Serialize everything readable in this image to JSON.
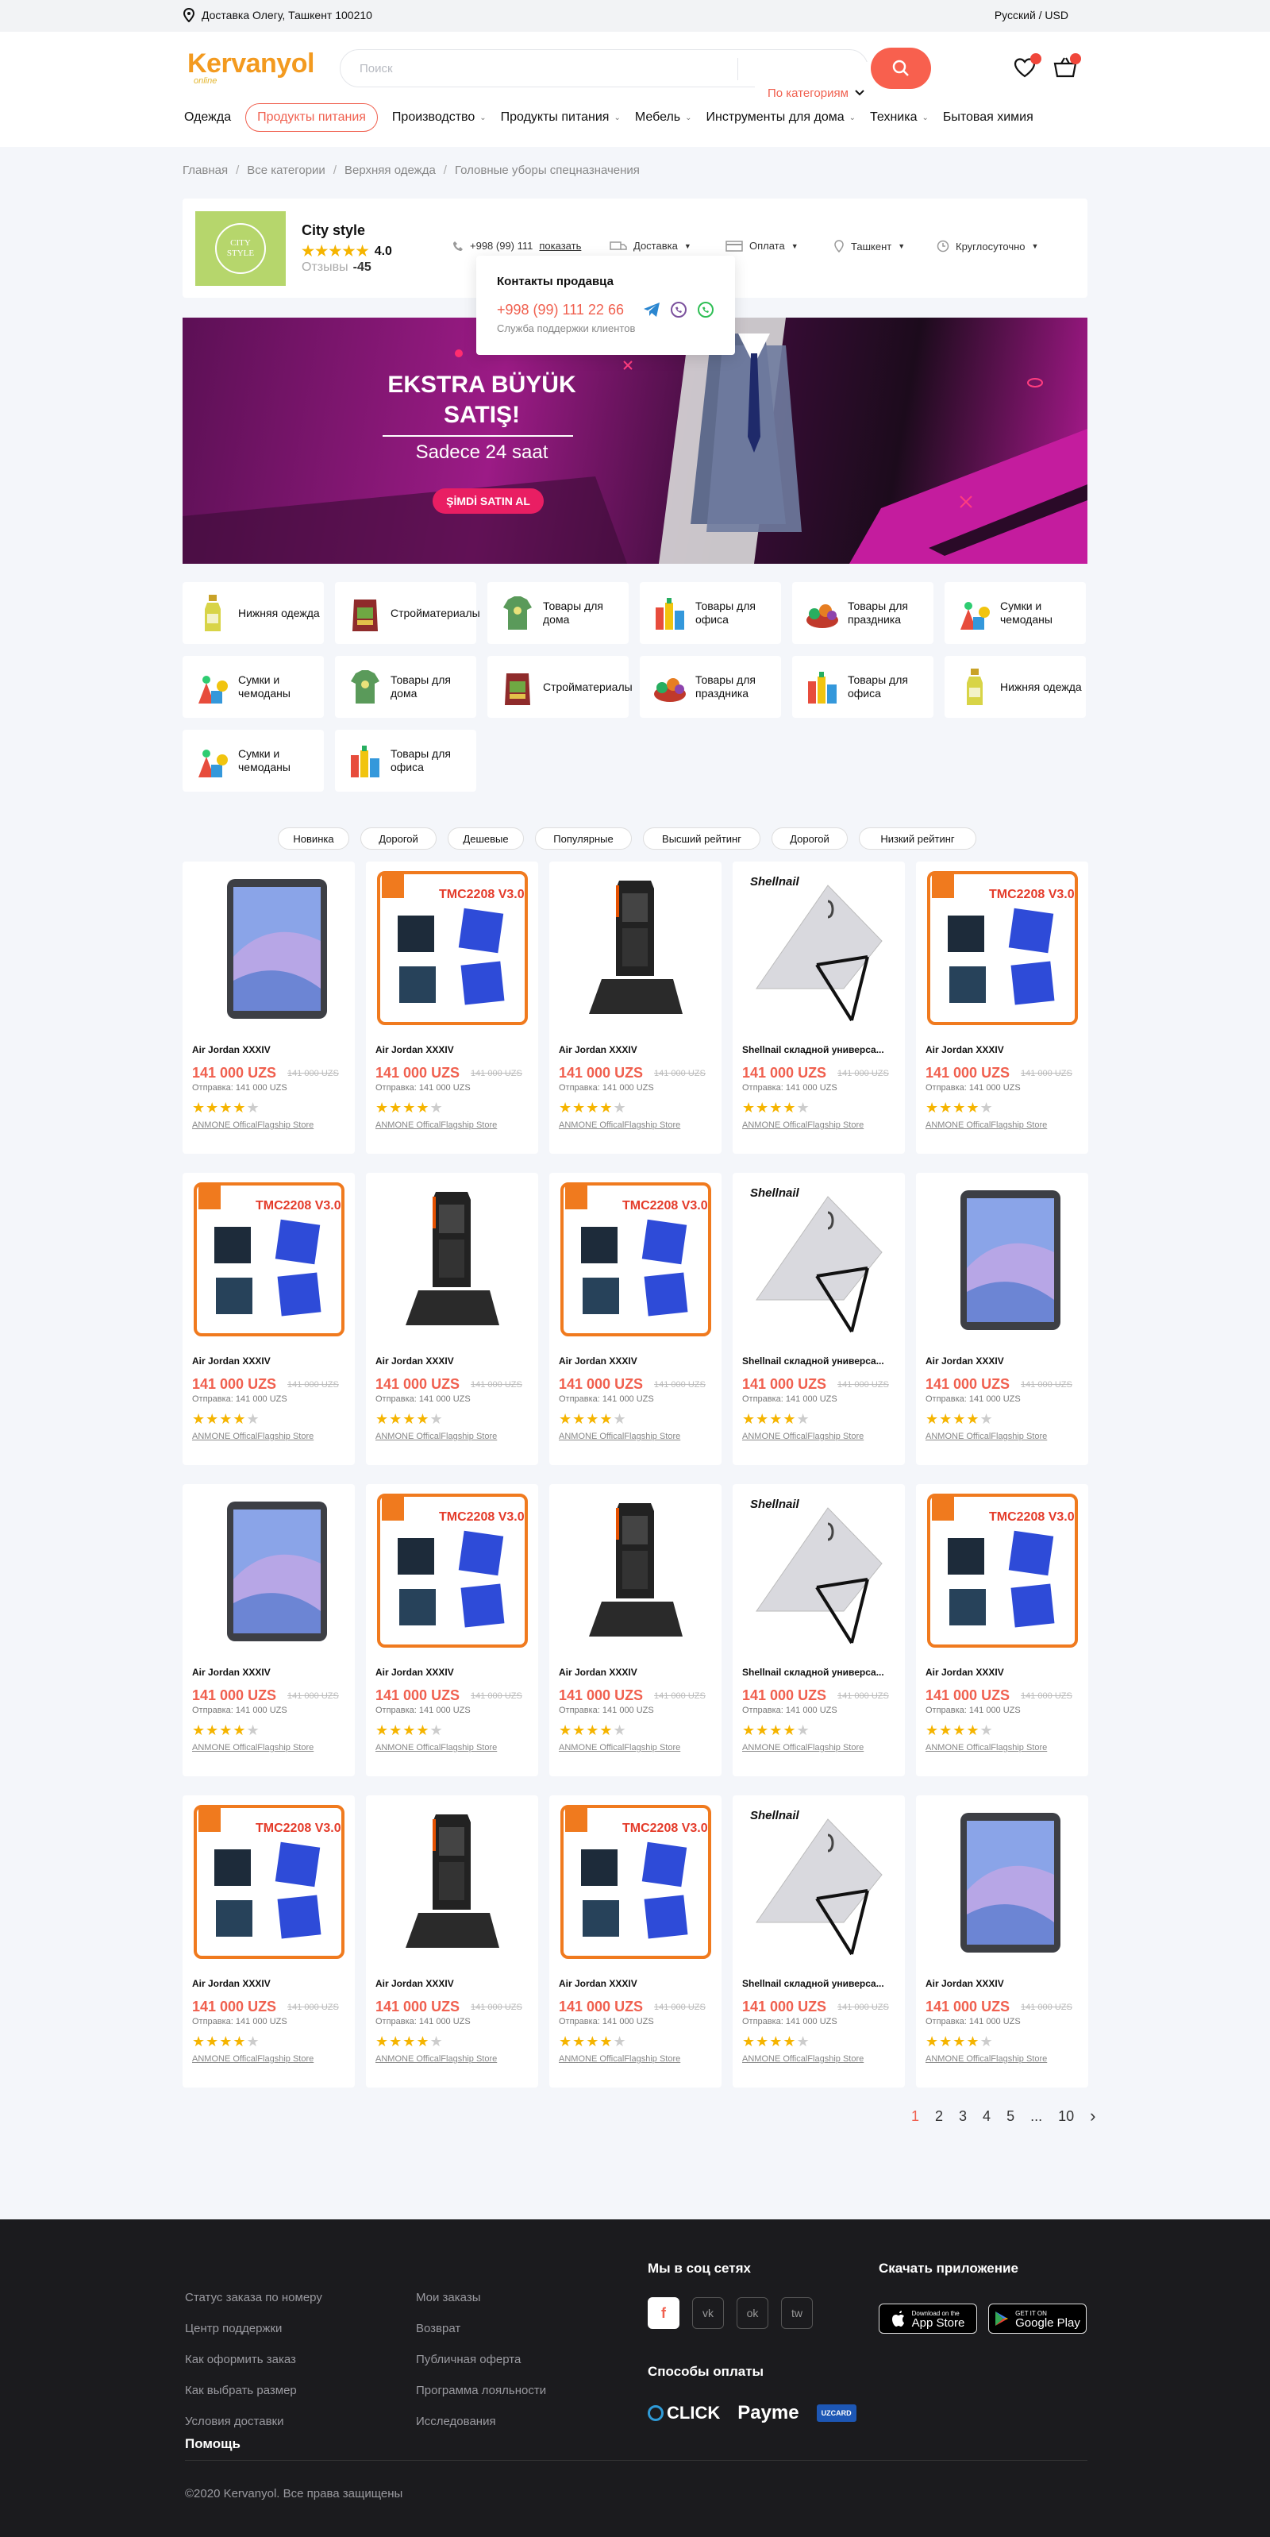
{
  "topbar": {
    "location": "Доставка Олегу, Ташкент 100210",
    "lang": "Русский / USD"
  },
  "header": {
    "logo": "Kervanyol",
    "logo_sub": "online",
    "search_placeholder": "Поиск",
    "search_category": "По категориям",
    "nav": [
      {
        "label": "Одежда",
        "active": false,
        "chev": false
      },
      {
        "label": "Продукты питания",
        "active": true,
        "chev": false
      },
      {
        "label": "Производство",
        "active": false,
        "chev": true
      },
      {
        "label": "Продукты питания",
        "active": false,
        "chev": true
      },
      {
        "label": "Мебель",
        "active": false,
        "chev": true
      },
      {
        "label": "Инструменты для дома",
        "active": false,
        "chev": true
      },
      {
        "label": "Техника",
        "active": false,
        "chev": true
      },
      {
        "label": "Бытовая химия",
        "active": false,
        "chev": false
      }
    ]
  },
  "breadcrumbs": [
    "Главная",
    "Все категории",
    "Верхняя одежда",
    "Головные уборы спецназначения"
  ],
  "seller": {
    "logo_text": "CITY STYLE",
    "name": "City style",
    "rating": "4.0",
    "reviews_label": "Отзывы",
    "reviews": "-45",
    "phone": "+998 (99) 111",
    "show": "показать",
    "delivery": "Доставка",
    "payment": "Оплата",
    "city": "Ташкент",
    "hours": "Круглосуточно",
    "popup": {
      "title": "Контакты продавца",
      "phone": "+998 (99) 111  22 66",
      "sub": "Служба поддержки клиентов"
    }
  },
  "banner": {
    "title": "EKSTRA BÜYÜK SATIŞ!",
    "subtitle": "Sadece 24 saat",
    "cta": "ŞİMDİ SATIN AL"
  },
  "categories": [
    {
      "label": "Нижняя одежда",
      "icon": "bottle"
    },
    {
      "label": "Стройматериалы",
      "icon": "bag"
    },
    {
      "label": "Товары для дома",
      "icon": "shirt"
    },
    {
      "label": "Товары для офиса",
      "icon": "cleaning"
    },
    {
      "label": "Товары для праздника",
      "icon": "basket"
    },
    {
      "label": "Сумки и чемоданы",
      "icon": "toys"
    },
    {
      "label": "Сумки и чемоданы",
      "icon": "toys"
    },
    {
      "label": "Товары для дома",
      "icon": "shirt"
    },
    {
      "label": "Стройматериалы",
      "icon": "bag"
    },
    {
      "label": "Товары для праздника",
      "icon": "basket"
    },
    {
      "label": "Товары для офиса",
      "icon": "cleaning"
    },
    {
      "label": "Нижняя одежда",
      "icon": "bottle"
    },
    {
      "label": "Сумки и чемоданы",
      "icon": "toys"
    },
    {
      "label": "Товары для офиса",
      "icon": "cleaning"
    }
  ],
  "filters": [
    "Новинка",
    "Дорогой",
    "Дешевые",
    "Популярные",
    "Высший рейтинг",
    "Дорогой",
    "Низкий рейтинг"
  ],
  "product_common": {
    "price": "141 000 UZS",
    "old_price": "141 000 UZS",
    "ship": "Отправка: 141 000 UZS",
    "store": "ANMONE OfficalFlagship Store",
    "rating": 4
  },
  "products": [
    {
      "name": "Air Jordan XXXIV",
      "img": "tablet"
    },
    {
      "name": "Air Jordan XXXIV",
      "img": "tmc"
    },
    {
      "name": "Air Jordan XXXIV",
      "img": "scanner"
    },
    {
      "name": "Shellnail складной универса...",
      "img": "stand"
    },
    {
      "name": "Air Jordan XXXIV",
      "img": "tmc"
    },
    {
      "name": "Air Jordan XXXIV",
      "img": "tmc"
    },
    {
      "name": "Air Jordan XXXIV",
      "img": "scanner"
    },
    {
      "name": "Air Jordan XXXIV",
      "img": "tmc"
    },
    {
      "name": "Shellnail складной универса...",
      "img": "stand"
    },
    {
      "name": "Air Jordan XXXIV",
      "img": "tablet"
    },
    {
      "name": "Air Jordan XXXIV",
      "img": "tablet"
    },
    {
      "name": "Air Jordan XXXIV",
      "img": "tmc"
    },
    {
      "name": "Air Jordan XXXIV",
      "img": "scanner"
    },
    {
      "name": "Shellnail складной универса...",
      "img": "stand"
    },
    {
      "name": "Air Jordan XXXIV",
      "img": "tmc"
    },
    {
      "name": "Air Jordan XXXIV",
      "img": "tmc"
    },
    {
      "name": "Air Jordan XXXIV",
      "img": "scanner"
    },
    {
      "name": "Air Jordan XXXIV",
      "img": "tmc"
    },
    {
      "name": "Shellnail складной универса...",
      "img": "stand"
    },
    {
      "name": "Air Jordan XXXIV",
      "img": "tablet"
    }
  ],
  "pagination": [
    "1",
    "2",
    "3",
    "4",
    "5",
    "...",
    "10"
  ],
  "footer": {
    "col1": [
      "Статус заказа по номеру",
      "Центр поддержки",
      "Как оформить заказ",
      "Как выбрать размер",
      "Условия доставки"
    ],
    "col2": [
      "Мои заказы",
      "Возврат",
      "Публичная оферта",
      "Программа лояльности",
      "Исследования"
    ],
    "social_title": "Мы в соц сетях",
    "socials": [
      "f",
      "vk",
      "ok",
      "tw"
    ],
    "payment_title": "Способы оплаты",
    "payments": [
      "CLICK",
      "Payme",
      "UZCARD"
    ],
    "app_title": "Скачать приложение",
    "app_store": "App Store",
    "app_store_small": "Download on the",
    "google": "Google Play",
    "google_small": "GET IT ON",
    "help": "Помощь",
    "copyright": "©2020 Kervanyol. Все права защищены"
  },
  "colors": {
    "accent": "#f0604f",
    "star": "#f5b400",
    "footer_bg": "#1b1b1e"
  }
}
